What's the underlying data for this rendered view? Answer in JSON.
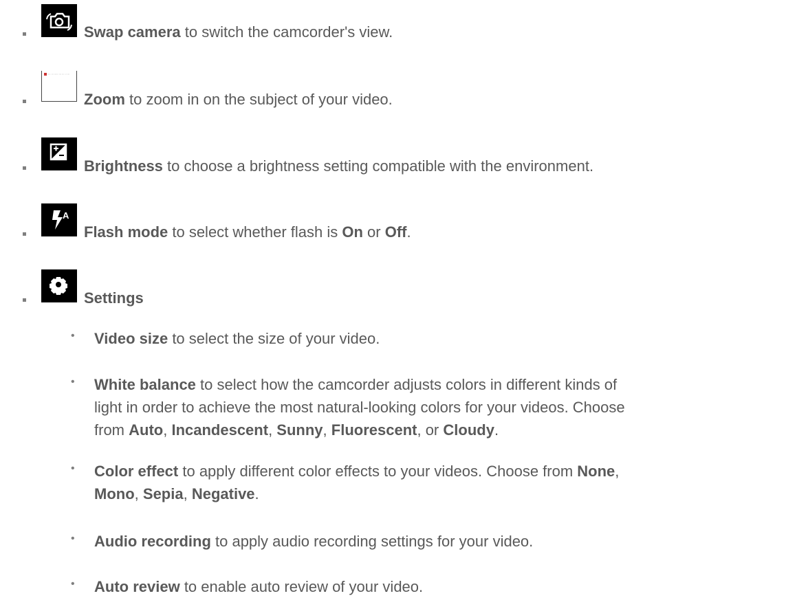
{
  "items": [
    {
      "icon": "swap-camera-icon",
      "label": "Swap camera",
      "text": " to switch the camcorder's view."
    },
    {
      "icon": "zoom-icon",
      "label": "Zoom",
      "text": " to zoom in on the subject of your video."
    },
    {
      "icon": "brightness-icon",
      "label": "Brightness",
      "text": " to choose a brightness setting compatible with the environment."
    },
    {
      "icon": "flash-mode-icon",
      "label": "Flash mode",
      "text_a": " to select whether flash is ",
      "bold_on": "On",
      "text_b": " or ",
      "bold_off": "Off",
      "text_c": "."
    },
    {
      "icon": "settings-icon",
      "label": "Settings"
    }
  ],
  "settings": [
    {
      "label": "Video size",
      "text": " to select the size of your video."
    },
    {
      "label": "White balance",
      "text_1": " to select how the camcorder adjusts colors in different kinds of",
      "text_2": "light in order to achieve the most natural-looking colors for your videos. Choose",
      "text_3a": "from ",
      "o1": "Auto",
      "s1": ", ",
      "o2": "Incandescent",
      "s2": ", ",
      "o3": "Sunny",
      "s3": ", ",
      "o4": "Fluorescent",
      "s4": ", or ",
      "o5": "Cloudy",
      "s5": "."
    },
    {
      "label": "Color effect",
      "text_1": " to apply different color effects to your videos. Choose from ",
      "o1": "None",
      "s1": ",",
      "o2": "Mono",
      "s2": ", ",
      "o3": "Sepia",
      "s3": ", ",
      "o4": "Negative",
      "s4": "."
    },
    {
      "label": "Audio recording",
      "text": " to apply audio recording settings for your video."
    },
    {
      "label": "Auto review",
      "text": " to enable auto review of your video."
    }
  ],
  "bullet_char": "•",
  "colors": {
    "text": "#595959",
    "bullet": "#7f7f7f",
    "icon_bg": "#000000"
  }
}
